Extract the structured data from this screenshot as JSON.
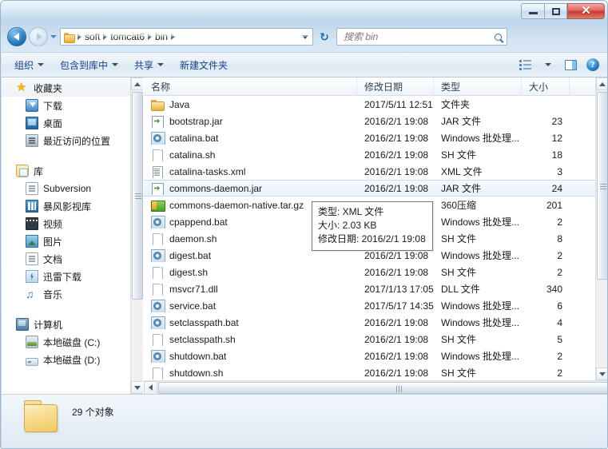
{
  "window": {
    "controls": {
      "minimize": "–",
      "maximize": "□",
      "close": "✕"
    }
  },
  "nav": {
    "back_title": "后退",
    "forward_title": "前进",
    "breadcrumbs": [
      "soft",
      "tomcat6",
      "bin"
    ],
    "refresh_glyph": "↻"
  },
  "search": {
    "placeholder": "搜索 bin",
    "value": ""
  },
  "toolbar": {
    "organize": "组织",
    "include_in_library": "包含到库中",
    "share": "共享",
    "new_folder": "新建文件夹",
    "views_title": "更改您的视图",
    "preview_title": "预览窗格",
    "help_glyph": "?"
  },
  "sidebar": {
    "groups": [
      {
        "head": {
          "label": "收藏夹",
          "icon": "star-icon"
        },
        "items": [
          {
            "label": "下载",
            "icon": "downloads-icon"
          },
          {
            "label": "桌面",
            "icon": "desktop-icon"
          },
          {
            "label": "最近访问的位置",
            "icon": "recent-places-icon"
          }
        ]
      },
      {
        "head": {
          "label": "库",
          "icon": "library-icon"
        },
        "items": [
          {
            "label": "Subversion",
            "icon": "document-icon"
          },
          {
            "label": "暴风影视库",
            "icon": "video-library-icon"
          },
          {
            "label": "视频",
            "icon": "film-icon"
          },
          {
            "label": "图片",
            "icon": "picture-icon"
          },
          {
            "label": "文档",
            "icon": "document-icon"
          },
          {
            "label": "迅雷下载",
            "icon": "thunder-download-icon"
          },
          {
            "label": "音乐",
            "icon": "music-icon"
          }
        ]
      },
      {
        "head": {
          "label": "计算机",
          "icon": "computer-icon"
        },
        "items": [
          {
            "label": "本地磁盘 (C:)",
            "icon": "system-drive-icon"
          },
          {
            "label": "本地磁盘 (D:)",
            "icon": "drive-icon"
          }
        ]
      }
    ]
  },
  "columns": [
    {
      "key": "name",
      "label": "名称"
    },
    {
      "key": "modified",
      "label": "修改日期"
    },
    {
      "key": "type",
      "label": "类型"
    },
    {
      "key": "size",
      "label": "大小"
    }
  ],
  "files": [
    {
      "name": "Java",
      "modified": "2017/5/11 12:51",
      "type": "文件夹",
      "size": "",
      "icon": "folder-icon",
      "selected": false
    },
    {
      "name": "bootstrap.jar",
      "modified": "2016/2/1 19:08",
      "type": "JAR 文件",
      "size": "23",
      "icon": "jar-icon",
      "selected": false
    },
    {
      "name": "catalina.bat",
      "modified": "2016/2/1 19:08",
      "type": "Windows 批处理...",
      "size": "12",
      "icon": "bat-icon",
      "selected": false
    },
    {
      "name": "catalina.sh",
      "modified": "2016/2/1 19:08",
      "type": "SH 文件",
      "size": "18",
      "icon": "file-icon",
      "selected": false
    },
    {
      "name": "catalina-tasks.xml",
      "modified": "2016/2/1 19:08",
      "type": "XML 文件",
      "size": "3",
      "icon": "xml-icon",
      "selected": false
    },
    {
      "name": "commons-daemon.jar",
      "modified": "2016/2/1 19:08",
      "type": "JAR 文件",
      "size": "24",
      "icon": "jar-icon",
      "selected": true
    },
    {
      "name": "commons-daemon-native.tar.gz",
      "modified": "",
      "type": "360压缩",
      "size": "201",
      "icon": "archive-icon",
      "selected": false
    },
    {
      "name": "cpappend.bat",
      "modified": "",
      "type": "Windows 批处理...",
      "size": "2",
      "icon": "bat-icon",
      "selected": false
    },
    {
      "name": "daemon.sh",
      "modified": "",
      "type": "SH 文件",
      "size": "8",
      "icon": "file-icon",
      "selected": false
    },
    {
      "name": "digest.bat",
      "modified": "2016/2/1 19:08",
      "type": "Windows 批处理...",
      "size": "2",
      "icon": "bat-icon",
      "selected": false
    },
    {
      "name": "digest.sh",
      "modified": "2016/2/1 19:08",
      "type": "SH 文件",
      "size": "2",
      "icon": "file-icon",
      "selected": false
    },
    {
      "name": "msvcr71.dll",
      "modified": "2017/1/13 17:05",
      "type": "DLL 文件",
      "size": "340",
      "icon": "file-icon",
      "selected": false
    },
    {
      "name": "service.bat",
      "modified": "2017/5/17 14:35",
      "type": "Windows 批处理...",
      "size": "6",
      "icon": "bat-icon",
      "selected": false
    },
    {
      "name": "setclasspath.bat",
      "modified": "2016/2/1 19:08",
      "type": "Windows 批处理...",
      "size": "4",
      "icon": "bat-icon",
      "selected": false
    },
    {
      "name": "setclasspath.sh",
      "modified": "2016/2/1 19:08",
      "type": "SH 文件",
      "size": "5",
      "icon": "file-icon",
      "selected": false
    },
    {
      "name": "shutdown.bat",
      "modified": "2016/2/1 19:08",
      "type": "Windows 批处理...",
      "size": "2",
      "icon": "bat-icon",
      "selected": false
    },
    {
      "name": "shutdown.sh",
      "modified": "2016/2/1 19:08",
      "type": "SH 文件",
      "size": "2",
      "icon": "file-icon",
      "selected": false
    }
  ],
  "tooltip": {
    "type_line": "类型: XML 文件",
    "size_line": "大小: 2.03 KB",
    "modified_line": "修改日期: 2016/2/1 19:08"
  },
  "statusbar": {
    "text": "29 个对象"
  },
  "colors": {
    "accent_blue": "#15428b",
    "selection": "#e8f1fa",
    "close_red": "#c8372c",
    "folder_yellow": "#f0c95f"
  }
}
